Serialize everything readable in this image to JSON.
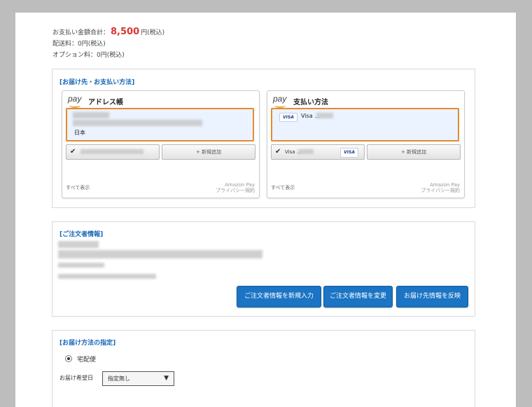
{
  "totals": {
    "total_label": "お支払い金額合計：",
    "total_amount": "8,500",
    "total_suffix": "円(税込)",
    "shipping_line": "配送料：0円(税込)",
    "option_line": "オプション料：0円(税込)"
  },
  "delivery_payment": {
    "title": "[お届け先・お支払い方法]",
    "pay_logo": "pay",
    "address_book": {
      "title": "アドレス帳",
      "country": "日本",
      "add_new": "+ 新規追加",
      "show_all": "すべて表示",
      "privacy_line1": "Amazon Pay",
      "privacy_line2": "プライバシー規約"
    },
    "payment_method": {
      "title": "支払い方法",
      "card_brand": "VISA",
      "card_label": "Visa ...",
      "selected_card": "Visa ...",
      "add_new": "+ 新規追加",
      "show_all": "すべて表示",
      "privacy_line1": "Amazon Pay",
      "privacy_line2": "プライバシー規約"
    }
  },
  "orderer": {
    "title": "[ご注文者情報]",
    "buttons": {
      "new_entry": "ご注文者情報を新規入力",
      "change": "ご注文者情報を変更",
      "reflect": "お届け先情報を反映"
    }
  },
  "delivery_method": {
    "title": "[お届け方法の指定]",
    "option_label": "宅配便",
    "date_label": "お届け希望日",
    "date_value": "指定無し",
    "date_arrow": "▼"
  },
  "icons": {
    "check": "✔",
    "colors": {
      "accent": "#1b74c4",
      "selected_border": "#e48b2f",
      "amount": "#dd3333"
    }
  }
}
